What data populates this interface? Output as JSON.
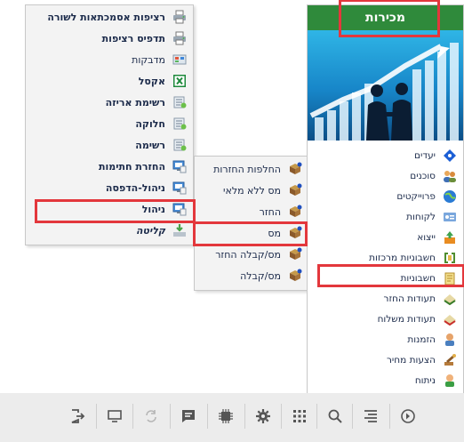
{
  "sales_panel": {
    "title": "מכירות",
    "items": [
      {
        "label": "יעדים",
        "icon": "target-diamond-icon"
      },
      {
        "label": "סוכנים",
        "icon": "agents-icon"
      },
      {
        "label": "פרוייקטים",
        "icon": "projects-globe-icon"
      },
      {
        "label": "לקוחות",
        "icon": "customers-card-icon"
      },
      {
        "label": "ייצוא",
        "icon": "export-box-icon"
      },
      {
        "label": "חשבוניות מרכזות",
        "icon": "central-invoices-icon"
      },
      {
        "label": "חשבוניות",
        "icon": "invoices-icon"
      },
      {
        "label": "תעודות החזר",
        "icon": "return-docs-icon"
      },
      {
        "label": "תעודות משלוח",
        "icon": "delivery-docs-icon"
      },
      {
        "label": "הזמנות",
        "icon": "orders-icon"
      },
      {
        "label": "הצעות מחיר",
        "icon": "price-quotes-icon"
      },
      {
        "label": "ניתוח",
        "icon": "analysis-icon"
      }
    ]
  },
  "invoice_submenu": {
    "items": [
      {
        "label": "החלפות החזרות",
        "icon": "exchange-returns-icon"
      },
      {
        "label": "מס ללא מלאי",
        "icon": "tax-no-stock-icon"
      },
      {
        "label": "החזר",
        "icon": "refund-icon"
      },
      {
        "label": "מס",
        "icon": "tax-icon"
      },
      {
        "label": "מס/קבלה החזר",
        "icon": "tax-receipt-refund-icon"
      },
      {
        "label": "מס/קבלה",
        "icon": "tax-receipt-icon"
      }
    ]
  },
  "tax_submenu": {
    "items": [
      {
        "label": "רציפות אסמכתאות לשורה",
        "icon": "reference-sequence-icon",
        "bold": true
      },
      {
        "label": "תדפיס רציפות",
        "icon": "sequence-printout-icon",
        "bold": true
      },
      {
        "label": "מדבקות",
        "icon": "stickers-icon",
        "bold": false
      },
      {
        "label": "אקסל",
        "icon": "excel-icon",
        "bold": true
      },
      {
        "label": "רשימת אריזה",
        "icon": "packing-list-icon",
        "bold": true
      },
      {
        "label": "חלוקה",
        "icon": "distribution-icon",
        "bold": true
      },
      {
        "label": "רשימה",
        "icon": "list-icon",
        "bold": true
      },
      {
        "label": "החזרת חתימות",
        "icon": "return-signatures-icon",
        "bold": true
      },
      {
        "label": "ניהול-הדפסה",
        "icon": "print-management-icon",
        "bold": true
      },
      {
        "label": "ניהול",
        "icon": "management-icon",
        "bold": true
      },
      {
        "label": "קליטה",
        "icon": "import-icon",
        "bold": true,
        "italic": true
      }
    ]
  },
  "toolbar": {
    "buttons": [
      "logout-icon",
      "monitor-icon",
      "sync-icon",
      "chat-icon",
      "chip-icon",
      "settings-gear-icon",
      "apps-grid-icon",
      "search-icon",
      "menu-lines-icon",
      "forward-circle-icon"
    ]
  },
  "colors": {
    "header_green": "#2f8a3b",
    "highlight_red": "#e3373c",
    "toolbar_bg": "#ececec"
  }
}
